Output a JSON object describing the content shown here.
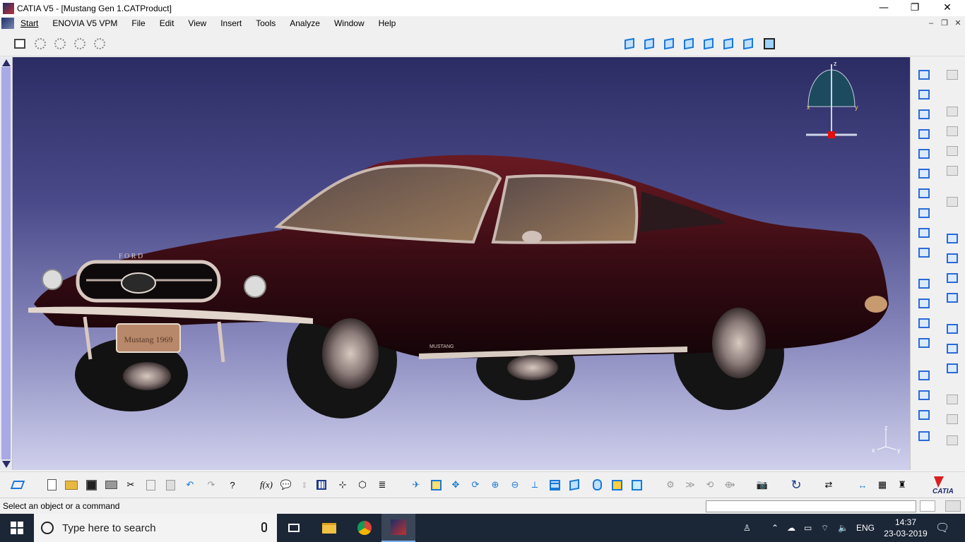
{
  "window": {
    "title": "CATIA V5 - [Mustang Gen 1.CATProduct]",
    "minimize": "—",
    "restore": "❐",
    "close": "✕"
  },
  "menu": {
    "items": [
      "Start",
      "ENOVIA V5 VPM",
      "File",
      "Edit",
      "View",
      "Insert",
      "Tools",
      "Analyze",
      "Window",
      "Help"
    ]
  },
  "model": {
    "plate_text": "Mustang 1969",
    "hood_text": "F O R D",
    "side_text": "MUSTANG"
  },
  "compass": {
    "z": "z",
    "x": "x",
    "y": "y"
  },
  "axis_triad": {
    "z": "z",
    "x": "x",
    "y": "y"
  },
  "status": {
    "prompt": "Select an object or a command",
    "command_value": ""
  },
  "brand": {
    "name": "CATIA"
  },
  "taskbar": {
    "search_placeholder": "Type here to search",
    "language": "ENG",
    "time": "14:37",
    "date": "23-03-2019"
  },
  "colors": {
    "accent_blue": "#1878d8",
    "viewport_top": "#2c2c64",
    "viewport_bottom": "#cfd0ec",
    "car_body": "#4a1018",
    "taskbar_bg": "#1b2636"
  }
}
